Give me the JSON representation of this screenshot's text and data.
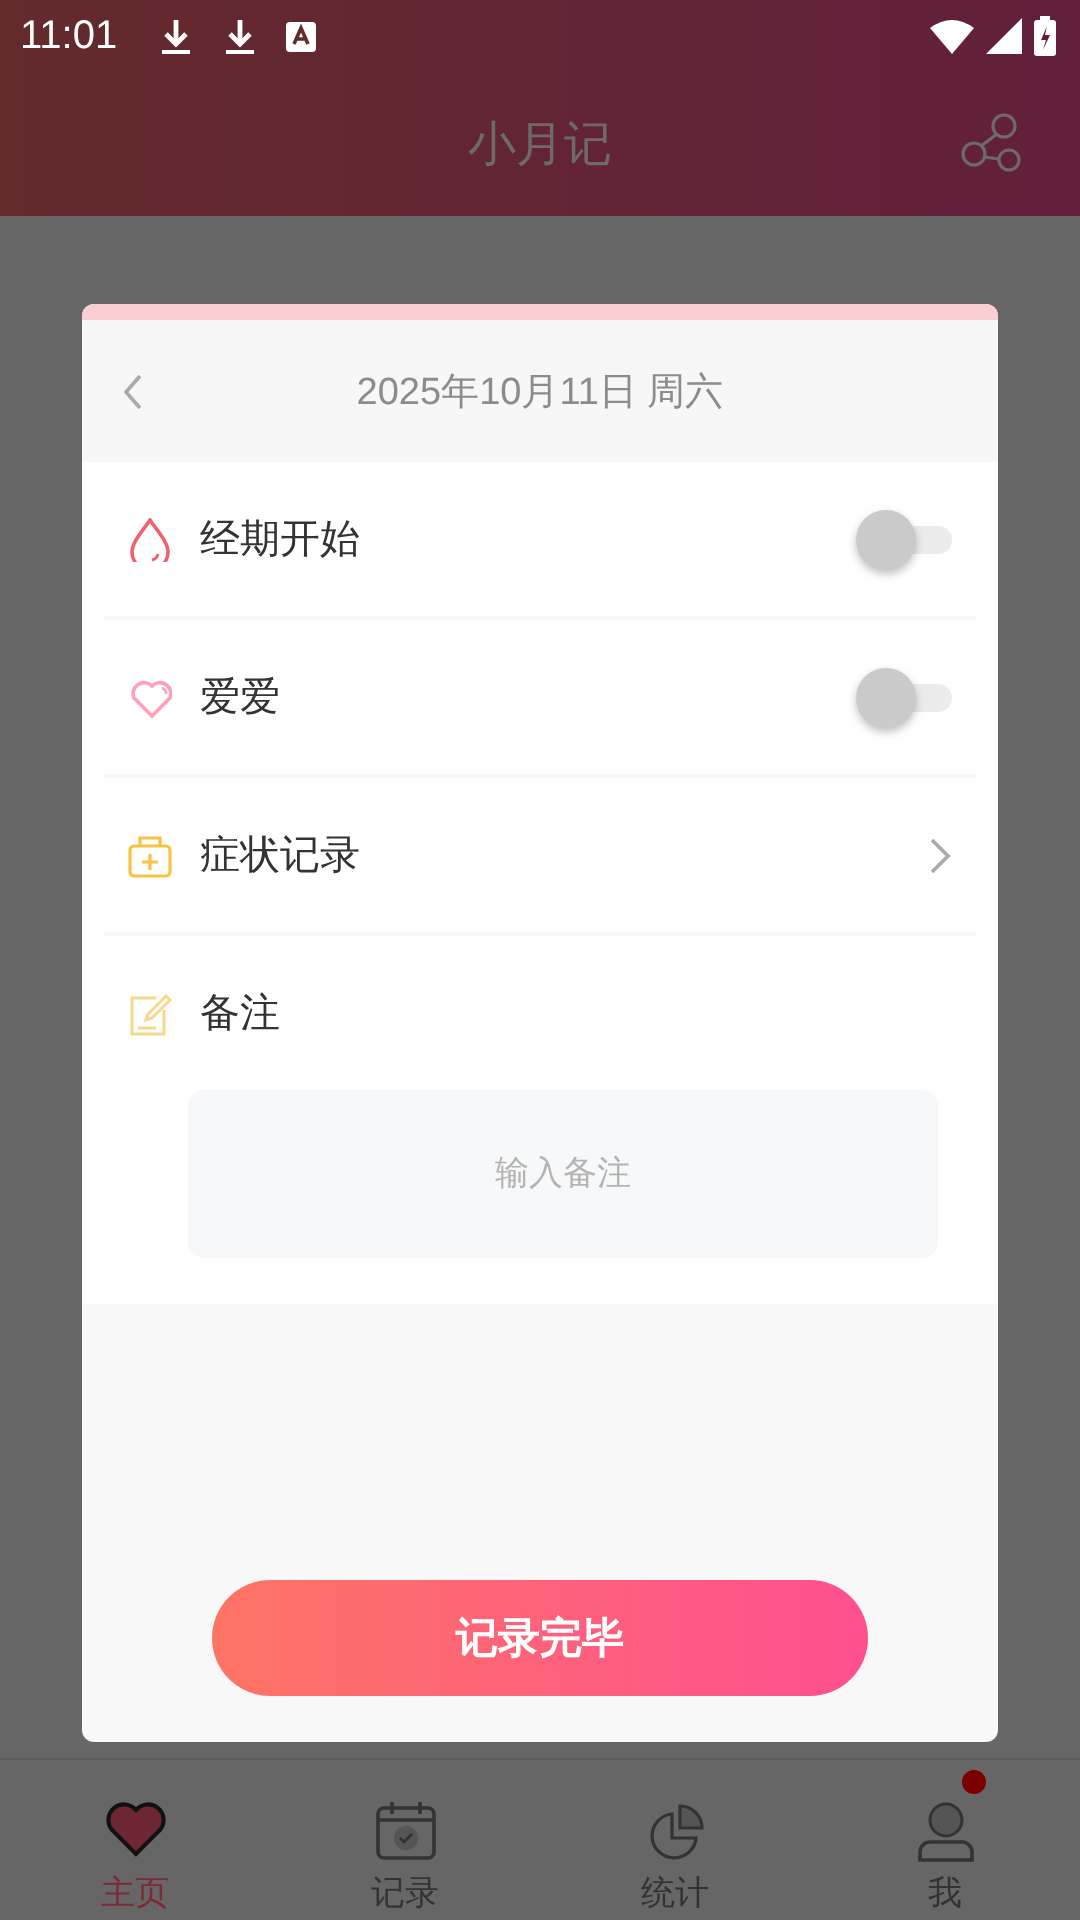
{
  "status_bar": {
    "time": "11:01"
  },
  "app_bar": {
    "title": "小月记"
  },
  "dialog": {
    "date": "2025年10月11日 周六",
    "rows": [
      {
        "kind": "toggle",
        "label": "经期开始",
        "on": false
      },
      {
        "kind": "toggle",
        "label": "爱爱",
        "on": false
      },
      {
        "kind": "link",
        "label": "症状记录"
      },
      {
        "kind": "note",
        "label": "备注",
        "placeholder": "输入备注"
      }
    ],
    "confirm": "记录完毕"
  },
  "bottom_nav": [
    {
      "label": "主页",
      "selected": true,
      "badge": false
    },
    {
      "label": "记录",
      "selected": false,
      "badge": false
    },
    {
      "label": "统计",
      "selected": false,
      "badge": false
    },
    {
      "label": "我",
      "selected": false,
      "badge": true
    }
  ]
}
